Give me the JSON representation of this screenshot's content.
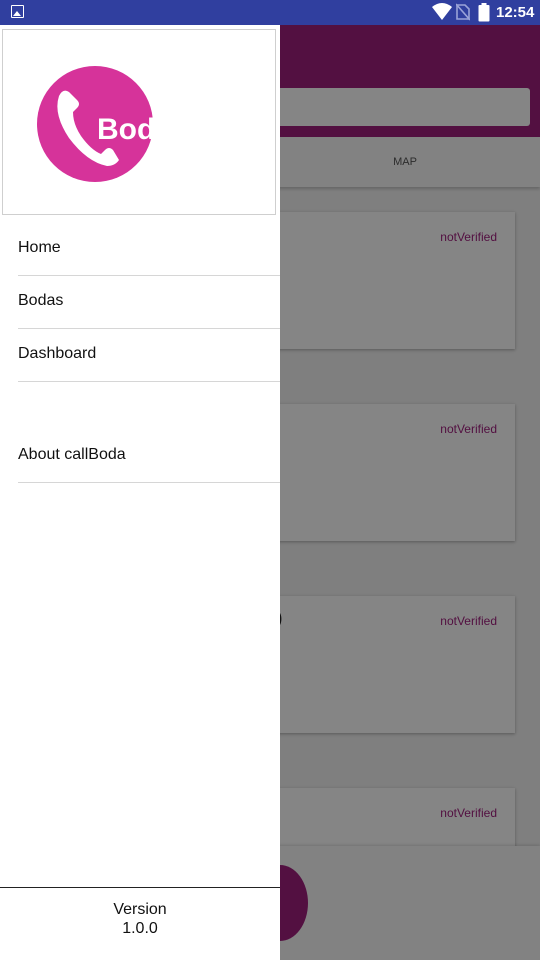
{
  "status_bar": {
    "time": "12:54",
    "icons": [
      "image-icon",
      "wifi-icon",
      "no-sim-icon",
      "battery-icon"
    ]
  },
  "background_app": {
    "tab_map_label": "MAP",
    "cards": [
      {
        "badge": "notVerified",
        "title_fragment": ""
      },
      {
        "badge": "notVerified",
        "title_fragment": ""
      },
      {
        "badge": "notVerified",
        "title_fragment": "a)"
      },
      {
        "badge": "notVerified",
        "title_fragment": ""
      }
    ]
  },
  "drawer": {
    "logo_text": "Boda",
    "menu": [
      {
        "label": "Home"
      },
      {
        "label": "Bodas"
      },
      {
        "label": "Dashboard"
      },
      {
        "label": "About callBoda"
      }
    ],
    "footer": {
      "version_label": "Version",
      "version_number": "1.0.0"
    }
  },
  "colors": {
    "status_bar": "#303f9f",
    "brand": "#a0207e",
    "logo_pink": "#d6339a"
  }
}
